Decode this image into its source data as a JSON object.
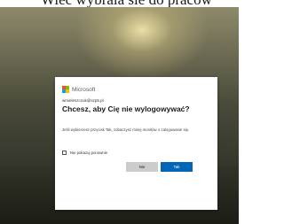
{
  "top_text": "Wiec wybrala sie do pracow",
  "dialog": {
    "brand": "Microsoft",
    "email": "wmieleszczuk@szp5.pl",
    "title": "Chcesz, aby Cię nie wylogowywać?",
    "description": "Jeśli wybierzesz przycisk Tak, zobaczysz mniej monitów o zalogowanie się.",
    "checkbox_label": "Nie pokazuj ponownie",
    "checkbox_checked": false,
    "no_button": "Nie",
    "yes_button": "Tak"
  },
  "colors": {
    "ms_red": "#f25022",
    "ms_green": "#7fba00",
    "ms_blue": "#00a4ef",
    "ms_yellow": "#ffb900",
    "primary_button": "#0067b8"
  }
}
